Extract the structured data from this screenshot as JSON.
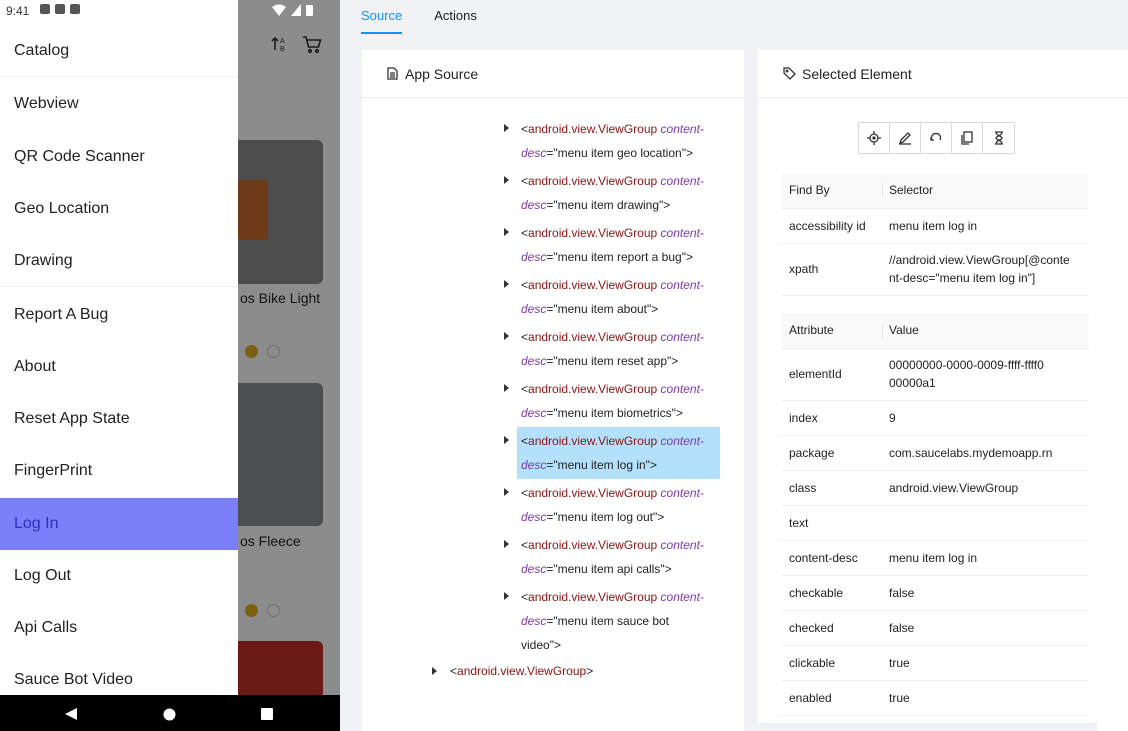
{
  "device": {
    "status_time": "9:41",
    "menu_items": [
      {
        "label": "Catalog",
        "active": false
      },
      {
        "label": "Webview",
        "active": false
      },
      {
        "label": "QR Code Scanner",
        "active": false
      },
      {
        "label": "Geo Location",
        "active": false
      },
      {
        "label": "Drawing",
        "active": false
      },
      {
        "label": "Report A Bug",
        "active": false
      },
      {
        "label": "About",
        "active": false
      },
      {
        "label": "Reset App State",
        "active": false
      },
      {
        "label": "FingerPrint",
        "active": false
      },
      {
        "label": "Log In",
        "active": true
      },
      {
        "label": "Log Out",
        "active": false
      },
      {
        "label": "Api Calls",
        "active": false
      },
      {
        "label": "Sauce Bot Video",
        "active": false
      }
    ],
    "background_products": [
      {
        "name_fragment": "os Bike Light"
      },
      {
        "name_fragment": "os Fleece"
      }
    ],
    "colors": {
      "active_item_bg": "#7b80fa",
      "active_item_text": "#2d2fc0",
      "star": "#e4b01c"
    }
  },
  "inspector": {
    "tabs": [
      {
        "label": "Source",
        "active": true
      },
      {
        "label": "Actions",
        "active": false
      }
    ],
    "source_panel": {
      "title": "App Source",
      "nodes": [
        {
          "tag": "android.view.ViewGroup",
          "attr": "content-desc",
          "attr_break": "content-",
          "attr_rest": "desc",
          "value": "\"menu item geo location\">",
          "selected": false
        },
        {
          "tag": "android.view.ViewGroup",
          "attr": "content-desc",
          "attr_break": "content-",
          "attr_rest": "desc",
          "value": "\"menu item drawing\">",
          "selected": false
        },
        {
          "tag": "android.view.ViewGroup",
          "attr": "content-desc",
          "attr_break": "content-",
          "attr_rest": "desc",
          "value": "\"menu item report a bug\">",
          "selected": false
        },
        {
          "tag": "android.view.ViewGroup",
          "attr": "content-desc",
          "attr_break": "content-",
          "attr_rest": "desc",
          "value": "\"menu item about\">",
          "selected": false
        },
        {
          "tag": "android.view.ViewGroup",
          "attr": "content-desc",
          "attr_break": "content-",
          "attr_rest": "desc",
          "value": "\"menu item reset app\">",
          "selected": false
        },
        {
          "tag": "android.view.ViewGroup",
          "attr": "content-desc",
          "attr_break": "content-",
          "attr_rest": "desc",
          "value": "\"menu item biometrics\">",
          "selected": false
        },
        {
          "tag": "android.view.ViewGroup",
          "attr": "content-desc",
          "attr_break": "content-",
          "attr_rest": "desc",
          "value": "\"menu item log in\">",
          "selected": true
        },
        {
          "tag": "android.view.ViewGroup",
          "attr": "content-desc",
          "attr_break": "content-",
          "attr_rest": "desc",
          "value": "\"menu item log out\">",
          "selected": false
        },
        {
          "tag": "android.view.ViewGroup",
          "attr": "content-desc",
          "attr_break": "content-",
          "attr_rest": "desc",
          "value": "\"menu item api calls\">",
          "selected": false
        },
        {
          "tag": "android.view.ViewGroup",
          "attr": "content-desc",
          "attr_break": "content-",
          "attr_rest": "desc",
          "value": "\"menu item sauce bot",
          "value_line3": "video\">",
          "selected": false
        }
      ],
      "parent_node": {
        "open": "<",
        "tag": "android.view.ViewGroup",
        "close": ">"
      }
    },
    "selected_panel": {
      "title": "Selected Element",
      "toolbar_icons": [
        "locate-icon",
        "pencil-icon",
        "undo-icon",
        "copy-icon",
        "hourglass-icon"
      ],
      "selectors_header": [
        "Find By",
        "Selector"
      ],
      "selectors": [
        {
          "by": "accessibility id",
          "selector": "menu item log in"
        },
        {
          "by": "xpath",
          "selector_line1": "//android.view.ViewGroup[@conte",
          "selector_line2": "nt-desc=\"menu item log in\"]"
        }
      ],
      "attributes_header": [
        "Attribute",
        "Value"
      ],
      "attributes": [
        {
          "name": "elementId",
          "value_line1": "00000000-0000-0009-ffff-ffff0",
          "value_line2": "00000a1"
        },
        {
          "name": "index",
          "value": "9"
        },
        {
          "name": "package",
          "value": "com.saucelabs.mydemoapp.rn"
        },
        {
          "name": "class",
          "value": "android.view.ViewGroup"
        },
        {
          "name": "text",
          "value": ""
        },
        {
          "name": "content-desc",
          "value": "menu item log in"
        },
        {
          "name": "checkable",
          "value": "false"
        },
        {
          "name": "checked",
          "value": "false"
        },
        {
          "name": "clickable",
          "value": "true"
        },
        {
          "name": "enabled",
          "value": "true"
        }
      ]
    },
    "colors": {
      "accent": "#1890ff",
      "tag": "#8a1515",
      "attr": "#7c3aa6",
      "selection": "#b3e0fb"
    }
  }
}
